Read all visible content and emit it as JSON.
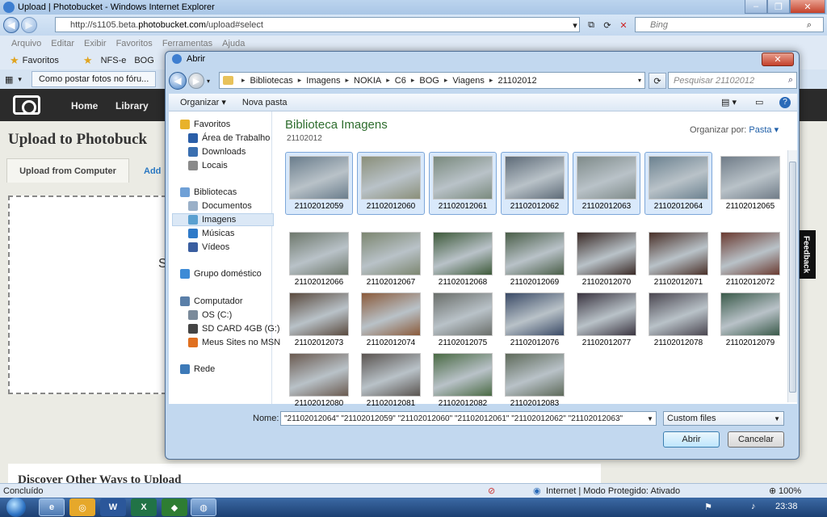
{
  "ie": {
    "title": "Upload | Photobucket - Windows Internet Explorer",
    "url_prefix": "http://s1105.beta.",
    "url_domain": "photobucket.com",
    "url_suffix": "/upload#select",
    "search_placeholder": "Bing",
    "menu": [
      "Arquivo",
      "Editar",
      "Exibir",
      "Favoritos",
      "Ferramentas",
      "Ajuda"
    ],
    "favorites_label": "Favoritos",
    "fav_links": [
      "NFS-e",
      "BOG"
    ],
    "tab_title": "Como postar fotos no fóru..."
  },
  "page": {
    "nav": [
      "Home",
      "Library"
    ],
    "heading": "Upload to Photobuck",
    "tab_upload": "Upload from Computer",
    "tab_add": "Add",
    "drop_partial": "S",
    "discover": "Discover Other Ways to Upload",
    "feedback": "Feedback"
  },
  "status": {
    "text": "Concluído",
    "zone": "Internet | Modo Protegido: Ativado",
    "zoom": "100%"
  },
  "taskbar": {
    "clock": "23:38"
  },
  "dialog": {
    "title": "Abrir",
    "breadcrumb": [
      "Bibliotecas",
      "Imagens",
      "NOKIA",
      "C6",
      "BOG",
      "Viagens",
      "21102012"
    ],
    "search_placeholder": "Pesquisar 21102012",
    "organize": "Organizar",
    "new_folder": "Nova pasta",
    "library_title": "Biblioteca Imagens",
    "library_sub": "21102012",
    "arrange_label": "Organizar por:",
    "arrange_value": "Pasta",
    "tree": [
      {
        "label": "Favoritos",
        "color": "#e8b22a"
      },
      {
        "label": "Área de Trabalho",
        "color": "#2a5ea8"
      },
      {
        "label": "Downloads",
        "color": "#3a6fb0"
      },
      {
        "label": "Locais",
        "color": "#8a8a8a"
      },
      {
        "label": "Bibliotecas",
        "color": "#6fa0d6"
      },
      {
        "label": "Documentos",
        "color": "#9ab0c8"
      },
      {
        "label": "Imagens",
        "color": "#5aa0d0"
      },
      {
        "label": "Músicas",
        "color": "#2f7ac8"
      },
      {
        "label": "Vídeos",
        "color": "#3a5ea0"
      },
      {
        "label": "Grupo doméstico",
        "color": "#3d8bd6"
      },
      {
        "label": "Computador",
        "color": "#5a7fa8"
      },
      {
        "label": "OS (C:)",
        "color": "#7a8a9a"
      },
      {
        "label": "SD CARD 4GB (G:)",
        "color": "#444"
      },
      {
        "label": "Meus Sites no MSN",
        "color": "#e07020"
      },
      {
        "label": "Rede",
        "color": "#3d7ab8"
      }
    ],
    "files": [
      {
        "name": "21102012059",
        "selected": true,
        "color": "#6a7d8c"
      },
      {
        "name": "21102012060",
        "selected": true,
        "color": "#8a8f7a"
      },
      {
        "name": "21102012061",
        "selected": true,
        "color": "#7a8a7e"
      },
      {
        "name": "21102012062",
        "selected": true,
        "color": "#5e6b78"
      },
      {
        "name": "21102012063",
        "selected": true,
        "color": "#7f8b8a"
      },
      {
        "name": "21102012064",
        "selected": true,
        "color": "#6c8290"
      },
      {
        "name": "21102012065",
        "selected": false,
        "color": "#707c88"
      },
      {
        "name": "21102012066",
        "selected": false,
        "color": "#6e786c"
      },
      {
        "name": "21102012067",
        "selected": false,
        "color": "#7c8670"
      },
      {
        "name": "21102012068",
        "selected": false,
        "color": "#3e5a3a"
      },
      {
        "name": "21102012069",
        "selected": false,
        "color": "#4a5e48"
      },
      {
        "name": "21102012070",
        "selected": false,
        "color": "#3a2a26"
      },
      {
        "name": "21102012071",
        "selected": false,
        "color": "#4a3028"
      },
      {
        "name": "21102012072",
        "selected": false,
        "color": "#6a3a30"
      },
      {
        "name": "21102012073",
        "selected": false,
        "color": "#5a4a3e"
      },
      {
        "name": "21102012074",
        "selected": false,
        "color": "#8a5a3a"
      },
      {
        "name": "21102012075",
        "selected": false,
        "color": "#6a6e6a"
      },
      {
        "name": "21102012076",
        "selected": false,
        "color": "#3a4a66"
      },
      {
        "name": "21102012077",
        "selected": false,
        "color": "#3a3440"
      },
      {
        "name": "21102012078",
        "selected": false,
        "color": "#4a4650"
      },
      {
        "name": "21102012079",
        "selected": false,
        "color": "#3a5a4a"
      },
      {
        "name": "21102012080",
        "selected": false,
        "color": "#6a5a50"
      },
      {
        "name": "21102012081",
        "selected": false,
        "color": "#5a5450"
      },
      {
        "name": "21102012082",
        "selected": false,
        "color": "#4a6a44"
      },
      {
        "name": "21102012083",
        "selected": false,
        "color": "#5e6a5a"
      }
    ],
    "filename_label": "Nome:",
    "filename_value": "\"21102012064\" \"21102012059\" \"21102012060\" \"21102012061\" \"21102012062\" \"21102012063\"",
    "filetype": "Custom files",
    "open_button": "Abrir",
    "cancel_button": "Cancelar"
  }
}
